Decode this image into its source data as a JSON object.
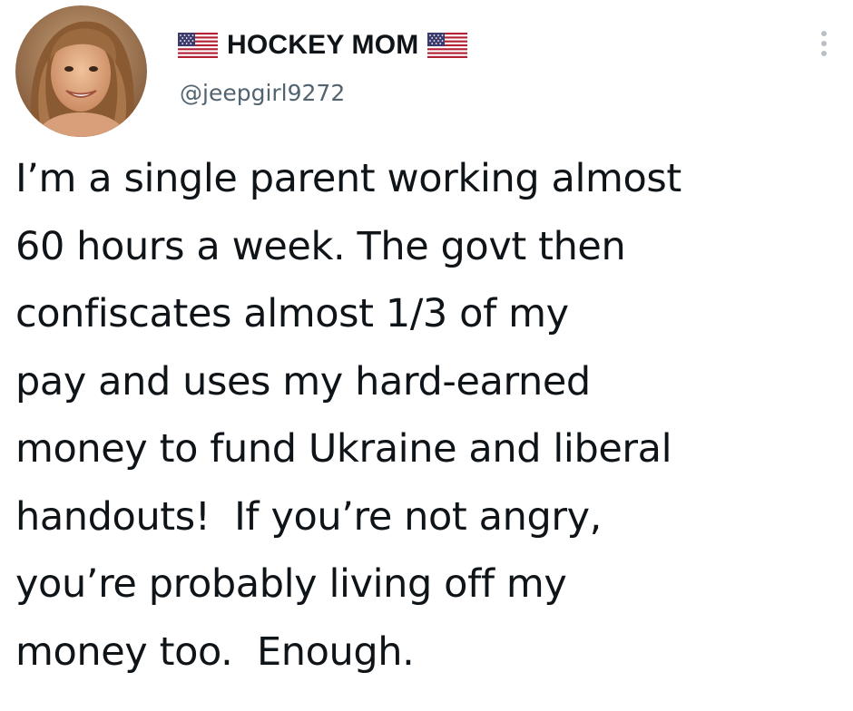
{
  "author": {
    "display_name": "HOCKEY MOM",
    "handle": "@jeepgirl9272",
    "name_prefix_icon": "us-flag-icon",
    "name_suffix_icon": "us-flag-icon",
    "avatar_icon": "profile-photo"
  },
  "menu": {
    "icon": "more-options-icon"
  },
  "tweet": {
    "lines": [
      "I’m a single parent working almost",
      "60 hours a week. The govt then",
      "confiscates almost 1/3 of my",
      "pay and uses my hard-earned",
      "money to fund Ukraine and liberal",
      "handouts!  If you’re not angry,",
      "you’re probably living off my",
      "money too.  Enough."
    ]
  },
  "colors": {
    "text": "#0f1419",
    "secondary_text": "#536471",
    "background": "#ffffff",
    "flag_red": "#b22234",
    "flag_blue": "#3c3b6e"
  }
}
